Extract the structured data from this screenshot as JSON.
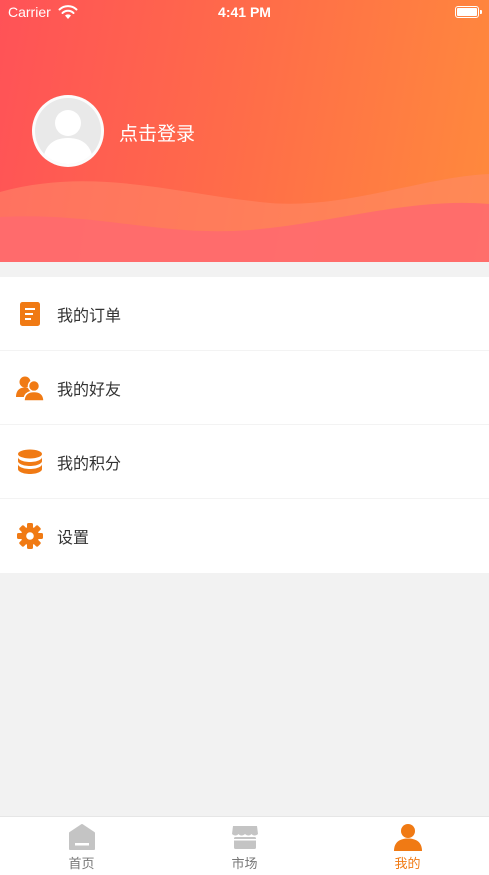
{
  "status_bar": {
    "carrier": "Carrier",
    "time": "4:41 PM"
  },
  "profile": {
    "login_label": "点击登录"
  },
  "menu": {
    "items": [
      {
        "label": "我的订单",
        "icon": "order-icon"
      },
      {
        "label": "我的好友",
        "icon": "friends-icon"
      },
      {
        "label": "我的积分",
        "icon": "points-icon"
      },
      {
        "label": "设置",
        "icon": "settings-icon"
      }
    ]
  },
  "tabbar": {
    "tabs": [
      {
        "label": "首页",
        "icon": "home-icon",
        "active": false
      },
      {
        "label": "市场",
        "icon": "market-icon",
        "active": false
      },
      {
        "label": "我的",
        "icon": "profile-icon",
        "active": true
      }
    ]
  },
  "colors": {
    "header_start": "#ff5257",
    "header_end": "#ff8a3c",
    "accent": "#f07a14",
    "inactive_icon": "#c4c4c4"
  }
}
